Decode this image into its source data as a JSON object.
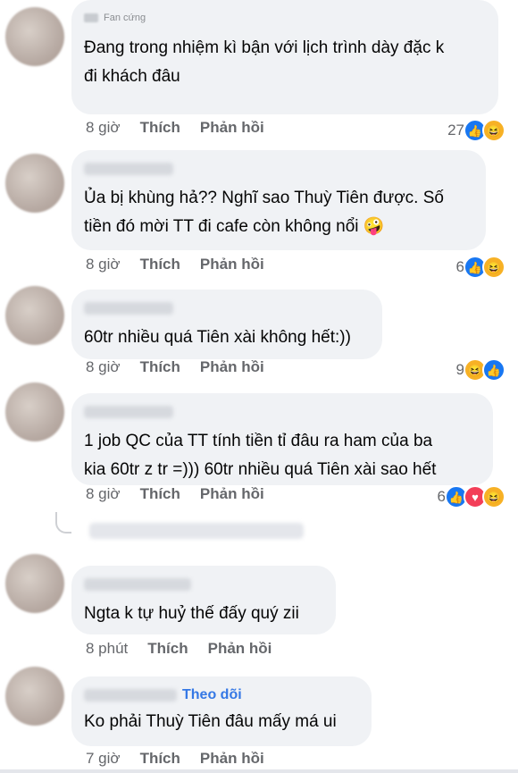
{
  "comments": [
    {
      "badge": "Fan cứng",
      "text_lines": [
        "Đang trong nhiệm kì bận với lịch trình dày đặc k",
        "đi khách đâu"
      ],
      "time": "8 giờ",
      "like": "Thích",
      "reply": "Phản hồi",
      "reaction_count": "27",
      "reactions": [
        "like",
        "haha"
      ]
    },
    {
      "text_lines": [
        "Ủa bị khùng hả?? Nghĩ sao Thuỳ Tiên được. Số",
        "tiền đó mời TT đi cafe còn không nổi 🤪"
      ],
      "time": "8 giờ",
      "like": "Thích",
      "reply": "Phản hồi",
      "reaction_count": "6",
      "reactions": [
        "like",
        "haha"
      ]
    },
    {
      "text_lines": [
        "60tr nhiều quá Tiên xài không hết:))"
      ],
      "time": "8 giờ",
      "like": "Thích",
      "reply": "Phản hồi",
      "reaction_count": "9",
      "reactions": [
        "haha",
        "like"
      ]
    },
    {
      "text_lines": [
        "1 job QC của TT tính tiền tỉ đâu ra ham của ba",
        "kia 60tr z tr =))) 60tr nhiều quá Tiên xài sao hết"
      ],
      "time": "8 giờ",
      "like": "Thích",
      "reply": "Phản hồi",
      "reaction_count": "6",
      "reactions": [
        "like",
        "love",
        "haha"
      ]
    },
    {
      "text_lines": [
        "Ngta k tự huỷ thế đấy quý zii"
      ],
      "time": "8 phút",
      "like": "Thích",
      "reply": "Phản hồi"
    },
    {
      "follow": "Theo dõi",
      "text_lines": [
        "Ko phải Thuỳ Tiên đâu mấy má ui"
      ],
      "time": "7 giờ",
      "like": "Thích",
      "reply": "Phản hồi"
    }
  ],
  "reaction_icons": {
    "like": "👍",
    "haha": "😆",
    "love": "♥"
  },
  "colors": {
    "bubble": "#f0f2f5",
    "meta": "#65676b",
    "follow": "#3578e5"
  }
}
